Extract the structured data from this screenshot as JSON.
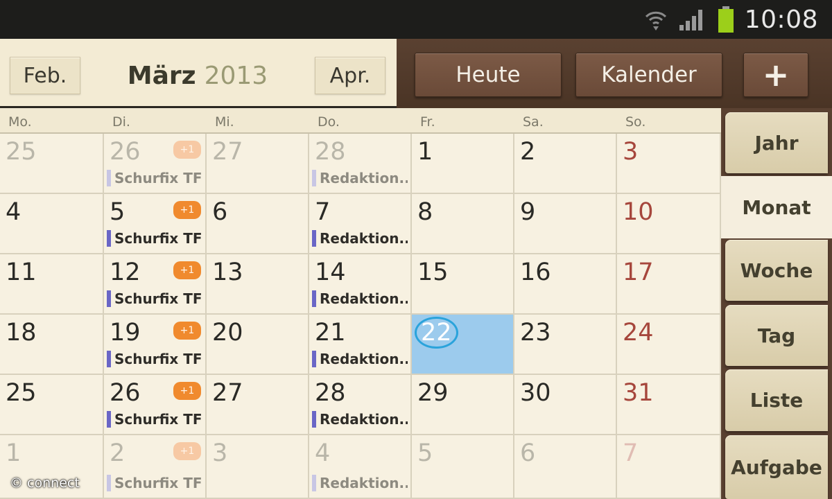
{
  "status_bar": {
    "time": "10:08",
    "icons": [
      "wifi-icon",
      "signal-icon",
      "battery-icon"
    ],
    "battery_color": "#9ccf1a"
  },
  "header": {
    "prev_label": "Feb.",
    "month": "März",
    "year": "2013",
    "next_label": "Apr."
  },
  "actions": {
    "today_label": "Heute",
    "calendar_label": "Kalender",
    "add_label": "+"
  },
  "weekdays": [
    "Mo.",
    "Di.",
    "Mi.",
    "Do.",
    "Fr.",
    "Sa.",
    "So."
  ],
  "weeks": [
    [
      {
        "day": "25",
        "other": true
      },
      {
        "day": "26",
        "other": true,
        "badge": "+1",
        "event": "Schurfix TF"
      },
      {
        "day": "27",
        "other": true
      },
      {
        "day": "28",
        "other": true,
        "event": "Redaktion.."
      },
      {
        "day": "1"
      },
      {
        "day": "2"
      },
      {
        "day": "3",
        "sunday": true
      }
    ],
    [
      {
        "day": "4"
      },
      {
        "day": "5",
        "badge": "+1",
        "event": "Schurfix TF"
      },
      {
        "day": "6"
      },
      {
        "day": "7",
        "event": "Redaktion.."
      },
      {
        "day": "8"
      },
      {
        "day": "9"
      },
      {
        "day": "10",
        "sunday": true
      }
    ],
    [
      {
        "day": "11"
      },
      {
        "day": "12",
        "badge": "+1",
        "event": "Schurfix TF"
      },
      {
        "day": "13"
      },
      {
        "day": "14",
        "event": "Redaktion.."
      },
      {
        "day": "15"
      },
      {
        "day": "16"
      },
      {
        "day": "17",
        "sunday": true
      }
    ],
    [
      {
        "day": "18"
      },
      {
        "day": "19",
        "badge": "+1",
        "event": "Schurfix TF"
      },
      {
        "day": "20"
      },
      {
        "day": "21",
        "event": "Redaktion.."
      },
      {
        "day": "22",
        "today": true
      },
      {
        "day": "23"
      },
      {
        "day": "24",
        "sunday": true
      }
    ],
    [
      {
        "day": "25"
      },
      {
        "day": "26",
        "badge": "+1",
        "event": "Schurfix TF"
      },
      {
        "day": "27"
      },
      {
        "day": "28",
        "event": "Redaktion.."
      },
      {
        "day": "29"
      },
      {
        "day": "30"
      },
      {
        "day": "31",
        "sunday": true
      }
    ],
    [
      {
        "day": "1",
        "other": true
      },
      {
        "day": "2",
        "other": true,
        "badge": "+1",
        "event": "Schurfix TF"
      },
      {
        "day": "3",
        "other": true
      },
      {
        "day": "4",
        "other": true,
        "event": "Redaktion.."
      },
      {
        "day": "5",
        "other": true
      },
      {
        "day": "6",
        "other": true
      },
      {
        "day": "7",
        "other": true,
        "sunday": true
      }
    ]
  ],
  "view_tabs": [
    {
      "label": "Jahr"
    },
    {
      "label": "Monat",
      "active": true
    },
    {
      "label": "Woche"
    },
    {
      "label": "Tag"
    },
    {
      "label": "Liste"
    },
    {
      "label": "Aufgabe"
    }
  ],
  "colors": {
    "today_fill": "#9ccbed",
    "sunday_text": "#a6463c",
    "badge": "#f08a2e",
    "event_bar": "#6a66c6",
    "toolbar": "#5a4131"
  },
  "watermark": "© connect"
}
